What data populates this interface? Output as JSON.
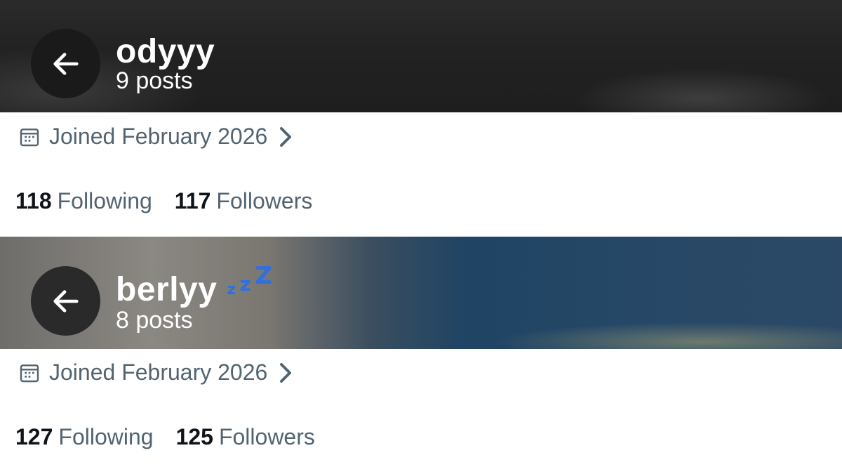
{
  "profiles": [
    {
      "display_name": "odyyy",
      "post_count": "9 posts",
      "joined": "Joined February 2026",
      "following_count": "118",
      "following_label": "Following",
      "followers_count": "117",
      "followers_label": "Followers"
    },
    {
      "display_name": "berlyy",
      "post_count": "8 posts",
      "status_emoji": "sleeping-zzz-icon",
      "joined": "Joined February 2026",
      "following_count": "127",
      "following_label": "Following",
      "followers_count": "125",
      "followers_label": "Followers"
    }
  ],
  "colors": {
    "secondary_text": "#536471",
    "primary_text": "#0f1419",
    "zzz_blue": "#2f6fe0"
  }
}
